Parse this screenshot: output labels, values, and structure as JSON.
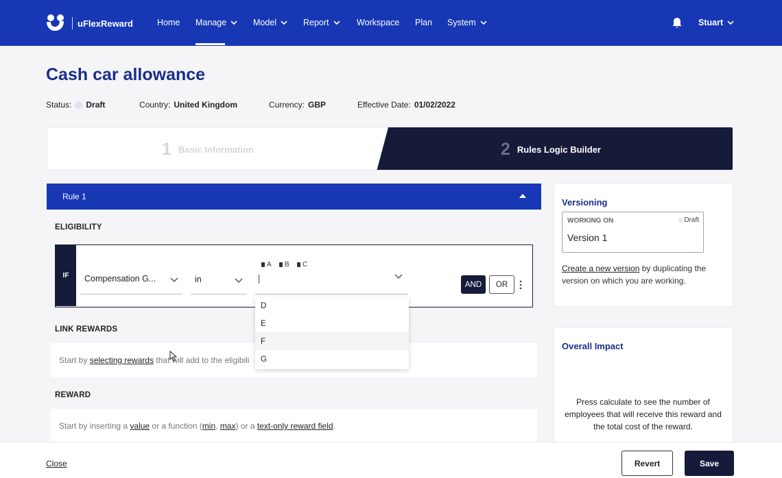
{
  "app": {
    "brand": "uFlexReward"
  },
  "nav": {
    "items": [
      {
        "label": "Home",
        "dropdown": false
      },
      {
        "label": "Manage",
        "dropdown": true,
        "active": true
      },
      {
        "label": "Model",
        "dropdown": true
      },
      {
        "label": "Report",
        "dropdown": true
      },
      {
        "label": "Workspace",
        "dropdown": false
      },
      {
        "label": "Plan",
        "dropdown": false
      },
      {
        "label": "System",
        "dropdown": true
      }
    ],
    "user": "Stuart"
  },
  "page": {
    "title": "Cash car allowance",
    "meta": {
      "status_label": "Status:",
      "status_value": "Draft",
      "country_label": "Country:",
      "country_value": "United Kingdom",
      "currency_label": "Currency:",
      "currency_value": "GBP",
      "date_label": "Effective Date:",
      "date_value": "01/02/2022"
    }
  },
  "stepper": {
    "steps": [
      {
        "num": "1",
        "label": "Basic Information",
        "active": false
      },
      {
        "num": "2",
        "label": "Rules Logic Builder",
        "active": true
      }
    ]
  },
  "rule": {
    "title": "Rule 1",
    "eligibility_label": "ELIGIBILITY",
    "if_label": "IF",
    "field": "Compensation G...",
    "operator": "in",
    "chips": [
      "A",
      "B",
      "C"
    ],
    "and_label": "AND",
    "or_label": "OR",
    "dropdown_options": [
      "D",
      "E",
      "F",
      "G"
    ],
    "link_rewards_label": "LINK REWARDS",
    "link_hint_pre": "Start by ",
    "link_hint_link": "selecting rewards",
    "link_hint_post": " that will add to the eligibili",
    "reward_label": "REWARD",
    "reward_hint_1": "Start by inserting a ",
    "reward_hint_value": "value",
    "reward_hint_2": " or a function (",
    "reward_hint_min": "min",
    "reward_hint_comma": ", ",
    "reward_hint_max": "max",
    "reward_hint_3": ") or a ",
    "reward_hint_text": "text-only reward field",
    "reward_hint_4": "."
  },
  "versioning": {
    "title": "Versioning",
    "working_on_label": "WORKING ON",
    "status": "Draft",
    "version_name": "Version 1",
    "create_link": "Create a new version",
    "create_text": " by duplicating the version on which you are working."
  },
  "impact": {
    "title": "Overall Impact",
    "text": "Press calculate to see the number of employees that will receive this reward and the total cost of the reward."
  },
  "footer": {
    "close": "Close",
    "revert": "Revert",
    "save": "Save"
  },
  "colors": {
    "brand_blue": "#1737b5",
    "navy": "#171b3a",
    "title_blue": "#1a2e8a"
  }
}
